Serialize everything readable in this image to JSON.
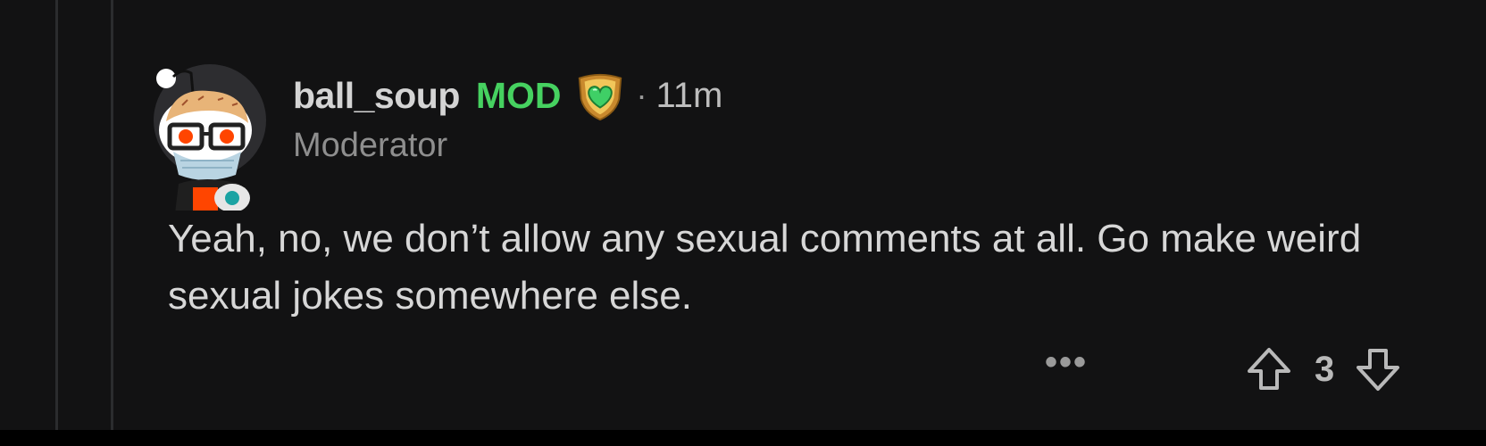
{
  "comment": {
    "username": "ball_soup",
    "mod_tag": "MOD",
    "separator": "·",
    "time": "11m",
    "flair": "Moderator",
    "body": "Yeah, no, we don’t allow any sexual comments at all. Go make weird sexual jokes somewhere else.",
    "score": "3",
    "more_label": "•••"
  },
  "icons": {
    "avatar": "snoo-avatar-icon",
    "mod_badge": "shield-heart-icon",
    "upvote": "upvote-arrow-icon",
    "downvote": "downvote-arrow-icon",
    "more": "more-options-icon"
  },
  "colors": {
    "background": "#121213",
    "mod_green": "#46d160",
    "text": "#d7d7d7",
    "muted": "#8e8e8e"
  }
}
